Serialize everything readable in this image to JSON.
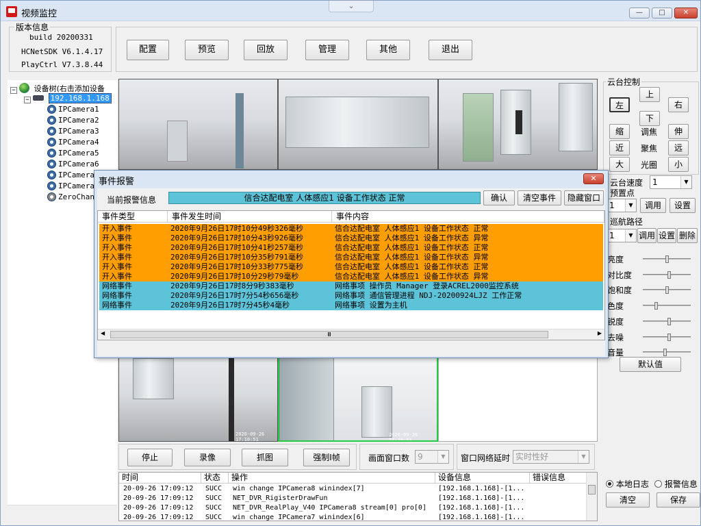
{
  "window": {
    "title": "视频监控",
    "dropdown_glyph": "⌄",
    "min": "—",
    "max": "□",
    "close": "✕"
  },
  "version": {
    "group": "版本信息",
    "build": "build 20200331",
    "sdk": "HCNetSDK V6.1.4.17",
    "playctrl": "PlayCtrl V7.3.8.44"
  },
  "toolbar": {
    "config": "配置",
    "preview": "预览",
    "playback": "回放",
    "manage": "管理",
    "other": "其他",
    "exit": "退出"
  },
  "tree": {
    "root": "设备树(右击添加设备",
    "device": "192.168.1.168",
    "cameras": [
      "IPCamera1",
      "IPCamera2",
      "IPCamera3",
      "IPCamera4",
      "IPCamera5",
      "IPCamera6",
      "IPCamera7",
      "IPCamera8"
    ],
    "zero": "ZeroChan",
    "expand": "−"
  },
  "video": {
    "stamp1": "2020-09-26 17:10:51",
    "stamp2": "2020-09-26 17:10:51"
  },
  "ptz": {
    "group": "云台控制",
    "up": "上",
    "left": "左",
    "right": "右",
    "down": "下",
    "zoom_in": "缩",
    "zoom_label": "调焦",
    "zoom_out": "伸",
    "focus_near": "近",
    "focus_label": "聚焦",
    "focus_far": "远",
    "iris_big": "大",
    "iris_label": "光圈",
    "iris_small": "小",
    "speed_label": "云台速度",
    "speed_value": "1",
    "preset_label": "预置点",
    "preset_value": "1",
    "preset_call": "调用",
    "preset_set": "设置",
    "cruise_label": "巡航路径",
    "cruise_value": "1",
    "cruise_call": "调用",
    "cruise_set": "设置",
    "cruise_del": "删除"
  },
  "image": {
    "brightness": "亮度",
    "contrast": "对比度",
    "saturation": "饱和度",
    "hue": "色度",
    "sharpness": "锐度",
    "denoise": "去噪",
    "volume": "音量",
    "default": "默认值",
    "levels": {
      "brightness": 0.5,
      "contrast": 0.55,
      "saturation": 0.5,
      "hue": 0.25,
      "sharpness": 0.55,
      "denoise": 0.55,
      "volume": 0.45
    }
  },
  "dialog": {
    "title": "事件报警",
    "current_label": "当前报警信息",
    "current_value": "信合达配电室 人体感应1 设备工作状态 正常",
    "confirm": "确认",
    "clear": "清空事件",
    "hide": "隐藏窗口",
    "close": "✕",
    "scroll_left": "◀",
    "scroll_right": "▶",
    "scroll_grip": "Ⅲ",
    "columns": [
      "事件类型",
      "事件发生时间",
      "事件内容"
    ],
    "rows": [
      {
        "type": "开入事件",
        "time": "2020年9月26日17时10分49秒326毫秒",
        "content": "信合达配电室 人体感应1 设备工作状态 正常",
        "color": "#ff9e00"
      },
      {
        "type": "开入事件",
        "time": "2020年9月26日17时10分43秒926毫秒",
        "content": "信合达配电室 人体感应1 设备工作状态 异常",
        "color": "#ff9e00"
      },
      {
        "type": "开入事件",
        "time": "2020年9月26日17时10分41秒257毫秒",
        "content": "信合达配电室 人体感应1 设备工作状态 正常",
        "color": "#ff9e00"
      },
      {
        "type": "开入事件",
        "time": "2020年9月26日17时10分35秒791毫秒",
        "content": "信合达配电室 人体感应1 设备工作状态 异常",
        "color": "#ff9e00"
      },
      {
        "type": "开入事件",
        "time": "2020年9月26日17时10分33秒775毫秒",
        "content": "信合达配电室 人体感应1 设备工作状态 正常",
        "color": "#ff9e00"
      },
      {
        "type": "开入事件",
        "time": "2020年9月26日17时10分29秒79毫秒",
        "content": "信合达配电室 人体感应1 设备工作状态 异常",
        "color": "#ff9e00"
      },
      {
        "type": "网络事件",
        "time": "2020年9月26日17时8分9秒383毫秒",
        "content": "网络事项 操作员 Manager 登录ACREL2000监控系统",
        "color": "#5cc3d8"
      },
      {
        "type": "网络事件",
        "time": "2020年9月26日17时7分54秒656毫秒",
        "content": "网络事项 通信管理进程 NDJ-20200924LJZ 工作正常",
        "color": "#5cc3d8"
      },
      {
        "type": "网络事件",
        "time": "2020年9月26日17时7分45秒4毫秒",
        "content": "网络事项 设置为主机",
        "color": "#5cc3d8"
      }
    ]
  },
  "controls": {
    "stop": "停止",
    "record": "录像",
    "capture": "抓图",
    "force_iframe": "强制I帧",
    "window_count_label": "画面窗口数",
    "window_count_value": "9",
    "net_delay_label": "窗口网络延时",
    "net_delay_value": "实时性好"
  },
  "log": {
    "columns": [
      "时间",
      "状态",
      "操作",
      "设备信息",
      "错误信息"
    ],
    "rows": [
      {
        "time": "20-09-26 17:09:12",
        "status": "SUCC",
        "op": "win change IPCamera8 winindex[7]",
        "dev": "[192.168.1.168]-[1..."
      },
      {
        "time": "20-09-26 17:09:12",
        "status": "SUCC",
        "op": "NET_DVR_RigisterDrawFun",
        "dev": "[192.168.1.168]-[1..."
      },
      {
        "time": "20-09-26 17:09:12",
        "status": "SUCC",
        "op": "NET_DVR_RealPlay_V40 IPCamera8 stream[0] pro[0]",
        "dev": "[192.168.1.168]-[1..."
      },
      {
        "time": "20-09-26 17:09:12",
        "status": "SUCC",
        "op": "win change IPCamera7 winindex[6]",
        "dev": "[192.168.1.168]-[1..."
      }
    ]
  },
  "logmode": {
    "local": "本地日志",
    "alarm": "报警信息",
    "clear": "清空",
    "save": "保存"
  }
}
